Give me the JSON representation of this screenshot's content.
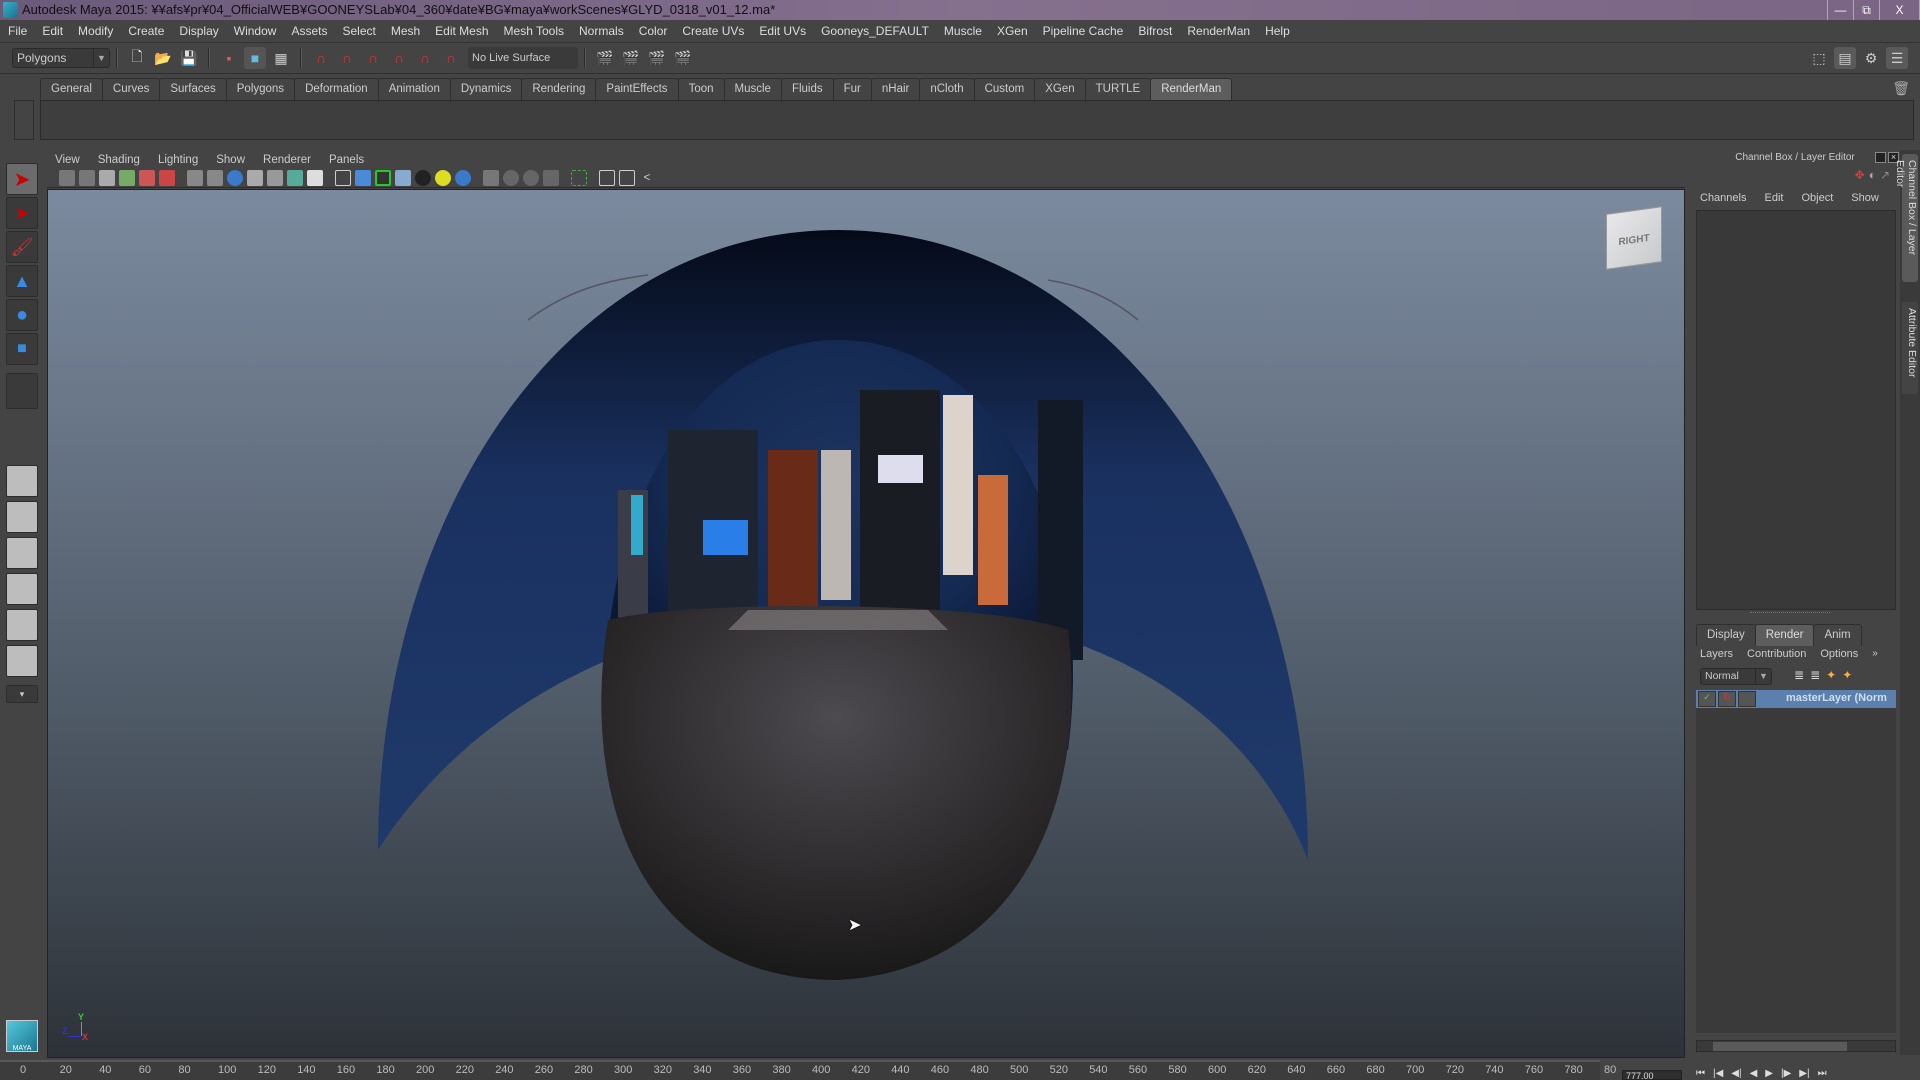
{
  "window": {
    "title": "Autodesk Maya 2015: ¥¥afs¥pr¥04_OfficialWEB¥GOONEYSLab¥04_360¥date¥BG¥maya¥workScenes¥GLYD_0318_v01_12.ma*",
    "controls": {
      "minimize": "—",
      "restore": "⧉",
      "close": "X"
    }
  },
  "menubar": [
    "File",
    "Edit",
    "Modify",
    "Create",
    "Display",
    "Window",
    "Assets",
    "Select",
    "Mesh",
    "Edit Mesh",
    "Mesh Tools",
    "Normals",
    "Color",
    "Create UVs",
    "Edit UVs",
    "Gooneys_DEFAULT",
    "Muscle",
    "XGen",
    "Pipeline Cache",
    "Bifrost",
    "RenderMan",
    "Help"
  ],
  "statusline": {
    "menuset": "Polygons",
    "live_surface": "No Live Surface",
    "icons": [
      "new-scene-icon",
      "open-scene-icon",
      "save-scene-icon",
      "select-by-hierarchy-icon",
      "select-by-object-icon",
      "select-by-component-icon",
      "snap-to-grid-icon",
      "snap-to-curve-icon",
      "snap-to-point-icon",
      "snap-to-view-plane-icon",
      "snap-to-live-icon",
      "make-live-icon",
      "render-view-icon",
      "render-current-frame-icon",
      "ipr-render-icon",
      "render-settings-icon"
    ],
    "right_icons": [
      "toggle-modeling-toolkit-icon",
      "attribute-editor-icon",
      "tool-settings-icon",
      "channel-box-icon"
    ]
  },
  "shelf": {
    "tabs": [
      "General",
      "Curves",
      "Surfaces",
      "Polygons",
      "Deformation",
      "Animation",
      "Dynamics",
      "Rendering",
      "PaintEffects",
      "Toon",
      "Muscle",
      "Fluids",
      "Fur",
      "nHair",
      "nCloth",
      "Custom",
      "XGen",
      "TURTLE",
      "RenderMan"
    ],
    "active_tab": "RenderMan"
  },
  "toolbox": [
    "select-tool",
    "lasso-tool",
    "paint-select-tool",
    "move-tool",
    "rotate-tool",
    "scale-tool",
    "last-used-tool",
    "empty-slot"
  ],
  "layouts": [
    "single-perspective-layout",
    "four-view-layout",
    "outliner-persp-layout",
    "persp-graph-layout",
    "hypershade-persp-layout",
    "persp-outliner-graph-layout"
  ],
  "viewport": {
    "menu": [
      "View",
      "Shading",
      "Lighting",
      "Show",
      "Renderer",
      "Panels"
    ],
    "view_cube_label": "RIGHT",
    "axis": {
      "y": "Y",
      "z": "Z",
      "x": "X"
    }
  },
  "channel_box": {
    "title": "Channel Box / Layer Editor",
    "menu": [
      "Channels",
      "Edit",
      "Object",
      "Show"
    ]
  },
  "layer_editor": {
    "tabs": [
      "Display",
      "Render",
      "Anim"
    ],
    "active_tab": "Render",
    "menu": [
      "Layers",
      "Contribution",
      "Options"
    ],
    "blend_mode": "Normal",
    "layers": [
      {
        "name": "masterLayer (Norm"
      }
    ]
  },
  "side_tabs": [
    "Channel Box / Layer Editor",
    "Attribute Editor"
  ],
  "timeline": {
    "ticks": [
      "0",
      "20",
      "40",
      "60",
      "80",
      "100",
      "120",
      "140",
      "160",
      "180",
      "200",
      "220",
      "240",
      "260",
      "280",
      "300",
      "320",
      "340",
      "360",
      "380",
      "400",
      "420",
      "440",
      "460",
      "480",
      "500",
      "520",
      "540",
      "560",
      "580",
      "600",
      "620",
      "640",
      "660",
      "680",
      "700",
      "720",
      "740",
      "760",
      "780",
      "80"
    ],
    "current_frame": "777.00"
  },
  "branding": {
    "logo_text": "MAYA"
  }
}
